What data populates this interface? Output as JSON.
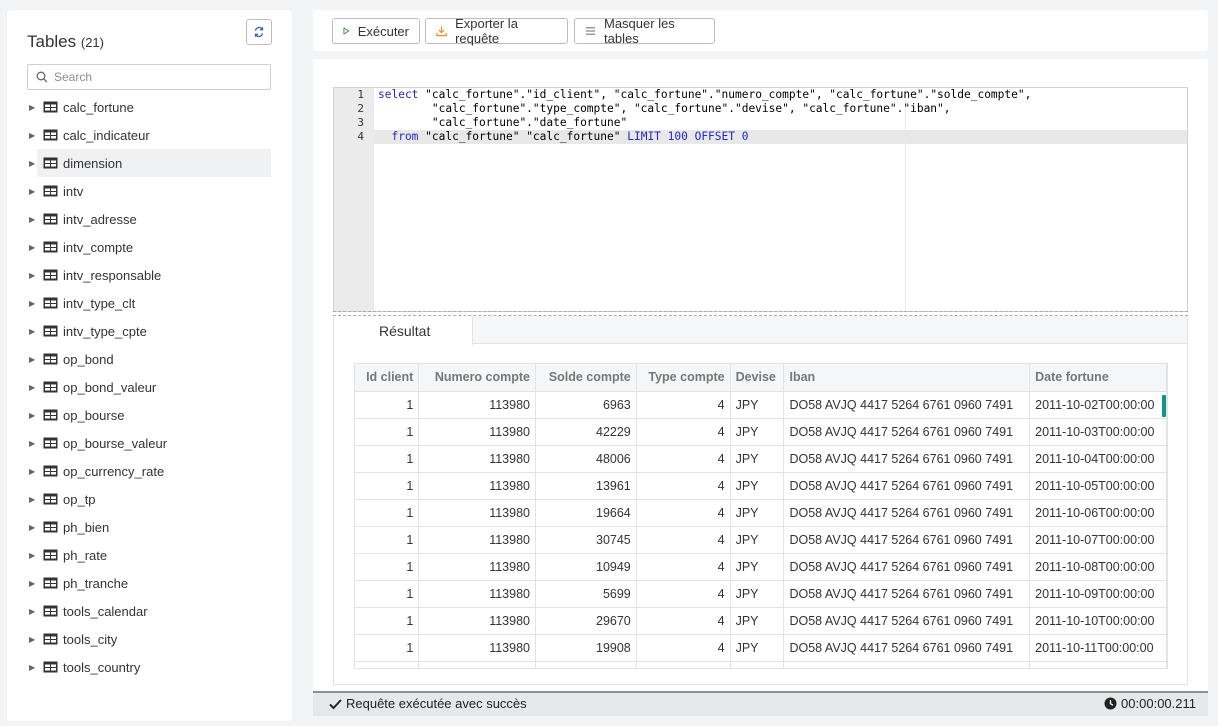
{
  "sidebar": {
    "title": "Tables",
    "count": "(21)",
    "search_placeholder": "Search",
    "tables": [
      "calc_fortune",
      "calc_indicateur",
      "dimension",
      "intv",
      "intv_adresse",
      "intv_compte",
      "intv_responsable",
      "intv_type_clt",
      "intv_type_cpte",
      "op_bond",
      "op_bond_valeur",
      "op_bourse",
      "op_bourse_valeur",
      "op_currency_rate",
      "op_tp",
      "ph_bien",
      "ph_rate",
      "ph_tranche",
      "tools_calendar",
      "tools_city",
      "tools_country"
    ],
    "selected_table": "dimension"
  },
  "toolbar": {
    "execute_label": "Exécuter",
    "export_label": "Exporter la requête",
    "hide_tables_label": "Masquer les tables"
  },
  "editor": {
    "line_numbers": [
      "1",
      "2",
      "3",
      "4"
    ],
    "lines": [
      {
        "kw": "select",
        "text": " \"calc_fortune\".\"id_client\", \"calc_fortune\".\"numero_compte\", \"calc_fortune\".\"solde_compte\","
      },
      {
        "kw": "",
        "text": "        \"calc_fortune\".\"type_compte\", \"calc_fortune\".\"devise\", \"calc_fortune\".\"iban\","
      },
      {
        "kw": "",
        "text": "        \"calc_fortune\".\"date_fortune\""
      },
      {
        "kw": "  from",
        "text": " \"calc_fortune\" \"calc_fortune\" ",
        "kw2": "LIMIT 100 OFFSET 0"
      }
    ]
  },
  "result": {
    "tab_label": "Résultat",
    "columns": [
      "Id client",
      "Numero compte",
      "Solde compte",
      "Type compte",
      "Devise",
      "Iban",
      "Date fortune"
    ],
    "rows": [
      [
        "1",
        "113980",
        "6963",
        "4",
        "JPY",
        "DO58 AVJQ 4417 5264 6761 0960 7491",
        "2011-10-02T00:00:00"
      ],
      [
        "1",
        "113980",
        "42229",
        "4",
        "JPY",
        "DO58 AVJQ 4417 5264 6761 0960 7491",
        "2011-10-03T00:00:00"
      ],
      [
        "1",
        "113980",
        "48006",
        "4",
        "JPY",
        "DO58 AVJQ 4417 5264 6761 0960 7491",
        "2011-10-04T00:00:00"
      ],
      [
        "1",
        "113980",
        "13961",
        "4",
        "JPY",
        "DO58 AVJQ 4417 5264 6761 0960 7491",
        "2011-10-05T00:00:00"
      ],
      [
        "1",
        "113980",
        "19664",
        "4",
        "JPY",
        "DO58 AVJQ 4417 5264 6761 0960 7491",
        "2011-10-06T00:00:00"
      ],
      [
        "1",
        "113980",
        "30745",
        "4",
        "JPY",
        "DO58 AVJQ 4417 5264 6761 0960 7491",
        "2011-10-07T00:00:00"
      ],
      [
        "1",
        "113980",
        "10949",
        "4",
        "JPY",
        "DO58 AVJQ 4417 5264 6761 0960 7491",
        "2011-10-08T00:00:00"
      ],
      [
        "1",
        "113980",
        "5699",
        "4",
        "JPY",
        "DO58 AVJQ 4417 5264 6761 0960 7491",
        "2011-10-09T00:00:00"
      ],
      [
        "1",
        "113980",
        "29670",
        "4",
        "JPY",
        "DO58 AVJQ 4417 5264 6761 0960 7491",
        "2011-10-10T00:00:00"
      ],
      [
        "1",
        "113980",
        "19908",
        "4",
        "JPY",
        "DO58 AVJQ 4417 5264 6761 0960 7491",
        "2011-10-11T00:00:00"
      ]
    ]
  },
  "status": {
    "message": "Requête exécutée avec succès",
    "duration": "00:00:00.211"
  },
  "colors": {
    "execute_icon": "#2a8a3a",
    "export_icon": "#e8902a",
    "refresh_icon": "#3b57d8",
    "sql_keyword": "#2525c8",
    "scroll_accent": "#0f9488"
  }
}
